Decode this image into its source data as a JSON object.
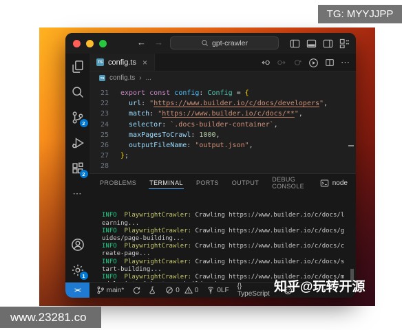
{
  "badges": {
    "top_right": "TG: MYYJJPP",
    "bottom_left": "www.23281.co"
  },
  "watermark": {
    "status_overlay": "知乎@玩转开源"
  },
  "icons": {
    "more_dots": "⋯"
  },
  "titlebar": {
    "search": "gpt-crawler",
    "back_arrow": "←",
    "forward_arrow": "→"
  },
  "tab": {
    "file_icon": "TS",
    "label": "config.ts",
    "close_icon": "×"
  },
  "breadcrumb": {
    "file": "config.ts",
    "separator": "›",
    "more": "..."
  },
  "editor": {
    "lines": [
      {
        "n": "21",
        "tokens": [
          {
            "t": "export",
            "c": "kw"
          },
          {
            "t": " ",
            "c": "p"
          },
          {
            "t": "const",
            "c": "kw"
          },
          {
            "t": " ",
            "c": "p"
          },
          {
            "t": "config",
            "c": "var"
          },
          {
            "t": ": ",
            "c": "p"
          },
          {
            "t": "Config",
            "c": "type"
          },
          {
            "t": " = ",
            "c": "p"
          },
          {
            "t": "{",
            "c": "brace"
          }
        ]
      },
      {
        "n": "22",
        "tokens": [
          {
            "t": "  url",
            "c": "prop"
          },
          {
            "t": ": ",
            "c": "p"
          },
          {
            "t": "\"",
            "c": "str"
          },
          {
            "t": "https://www.builder.io/c/docs/developers",
            "c": "strlink"
          },
          {
            "t": "\"",
            "c": "str"
          },
          {
            "t": ",",
            "c": "p"
          }
        ]
      },
      {
        "n": "23",
        "tokens": [
          {
            "t": "  match",
            "c": "prop"
          },
          {
            "t": ": ",
            "c": "p"
          },
          {
            "t": "\"",
            "c": "str"
          },
          {
            "t": "https://www.builder.io/c/docs/**",
            "c": "strlink"
          },
          {
            "t": "\"",
            "c": "str"
          },
          {
            "t": ",",
            "c": "p"
          }
        ]
      },
      {
        "n": "24",
        "tokens": [
          {
            "t": "  selector",
            "c": "prop"
          },
          {
            "t": ": ",
            "c": "p"
          },
          {
            "t": "`.docs-builder-container`",
            "c": "str"
          },
          {
            "t": ",",
            "c": "p"
          }
        ]
      },
      {
        "n": "25",
        "tokens": [
          {
            "t": "  maxPagesToCrawl",
            "c": "prop"
          },
          {
            "t": ": ",
            "c": "p"
          },
          {
            "t": "1000",
            "c": "num"
          },
          {
            "t": ",",
            "c": "p"
          }
        ]
      },
      {
        "n": "26",
        "tokens": [
          {
            "t": "  outputFileName",
            "c": "prop"
          },
          {
            "t": ": ",
            "c": "p"
          },
          {
            "t": "\"output.json\"",
            "c": "str"
          },
          {
            "t": ",",
            "c": "p"
          }
        ]
      },
      {
        "n": "27",
        "tokens": [
          {
            "t": "}",
            "c": "brace"
          },
          {
            "t": ";",
            "c": "p"
          }
        ]
      },
      {
        "n": "28",
        "tokens": []
      }
    ]
  },
  "panel": {
    "tabs": [
      {
        "label": "PROBLEMS"
      },
      {
        "label": "TERMINAL"
      },
      {
        "label": "PORTS"
      },
      {
        "label": "OUTPUT"
      },
      {
        "label": "DEBUG CONSOLE"
      }
    ],
    "runtime": "node"
  },
  "terminal": {
    "lines": [
      [
        {
          "t": "INFO",
          "c": "info"
        },
        {
          "t": "  ",
          "c": "plain"
        },
        {
          "t": "PlaywrightCrawler:",
          "c": "crawler"
        },
        {
          "t": " Crawling https://www.builder.io/c/docs/l",
          "c": "plain"
        }
      ],
      [
        {
          "t": "earning...",
          "c": "plain"
        }
      ],
      [
        {
          "t": "INFO",
          "c": "info"
        },
        {
          "t": "  ",
          "c": "plain"
        },
        {
          "t": "PlaywrightCrawler:",
          "c": "crawler"
        },
        {
          "t": " Crawling https://www.builder.io/c/docs/g",
          "c": "plain"
        }
      ],
      [
        {
          "t": "uides/page-building...",
          "c": "plain"
        }
      ],
      [
        {
          "t": "INFO",
          "c": "info"
        },
        {
          "t": "  ",
          "c": "plain"
        },
        {
          "t": "PlaywrightCrawler:",
          "c": "crawler"
        },
        {
          "t": " Crawling https://www.builder.io/c/docs/c",
          "c": "plain"
        }
      ],
      [
        {
          "t": "reate-page...",
          "c": "plain"
        }
      ],
      [
        {
          "t": "INFO",
          "c": "info"
        },
        {
          "t": "  ",
          "c": "plain"
        },
        {
          "t": "PlaywrightCrawler:",
          "c": "crawler"
        },
        {
          "t": " Crawling https://www.builder.io/c/docs/s",
          "c": "plain"
        }
      ],
      [
        {
          "t": "tart-building...",
          "c": "plain"
        }
      ],
      [
        {
          "t": "INFO",
          "c": "info"
        },
        {
          "t": "  ",
          "c": "plain"
        },
        {
          "t": "PlaywrightCrawler:",
          "c": "crawler"
        },
        {
          "t": " Crawling https://www.builder.io/c/docs/m",
          "c": "plain"
        }
      ],
      [
        {
          "t": "odels-intro?_host=www.builder.io...",
          "c": "plain"
        }
      ],
      [
        {
          "t": " ",
          "c": "cursor"
        }
      ]
    ]
  },
  "statusbar": {
    "remote_icon_text": "><",
    "branch": "main*",
    "errors": "0",
    "warnings": "0",
    "ports": "0",
    "eol": "LF",
    "language": "{} TypeScript"
  },
  "activitybar": {
    "scm_badge": "2",
    "extensions_badge": "2",
    "settings_badge": "1"
  }
}
